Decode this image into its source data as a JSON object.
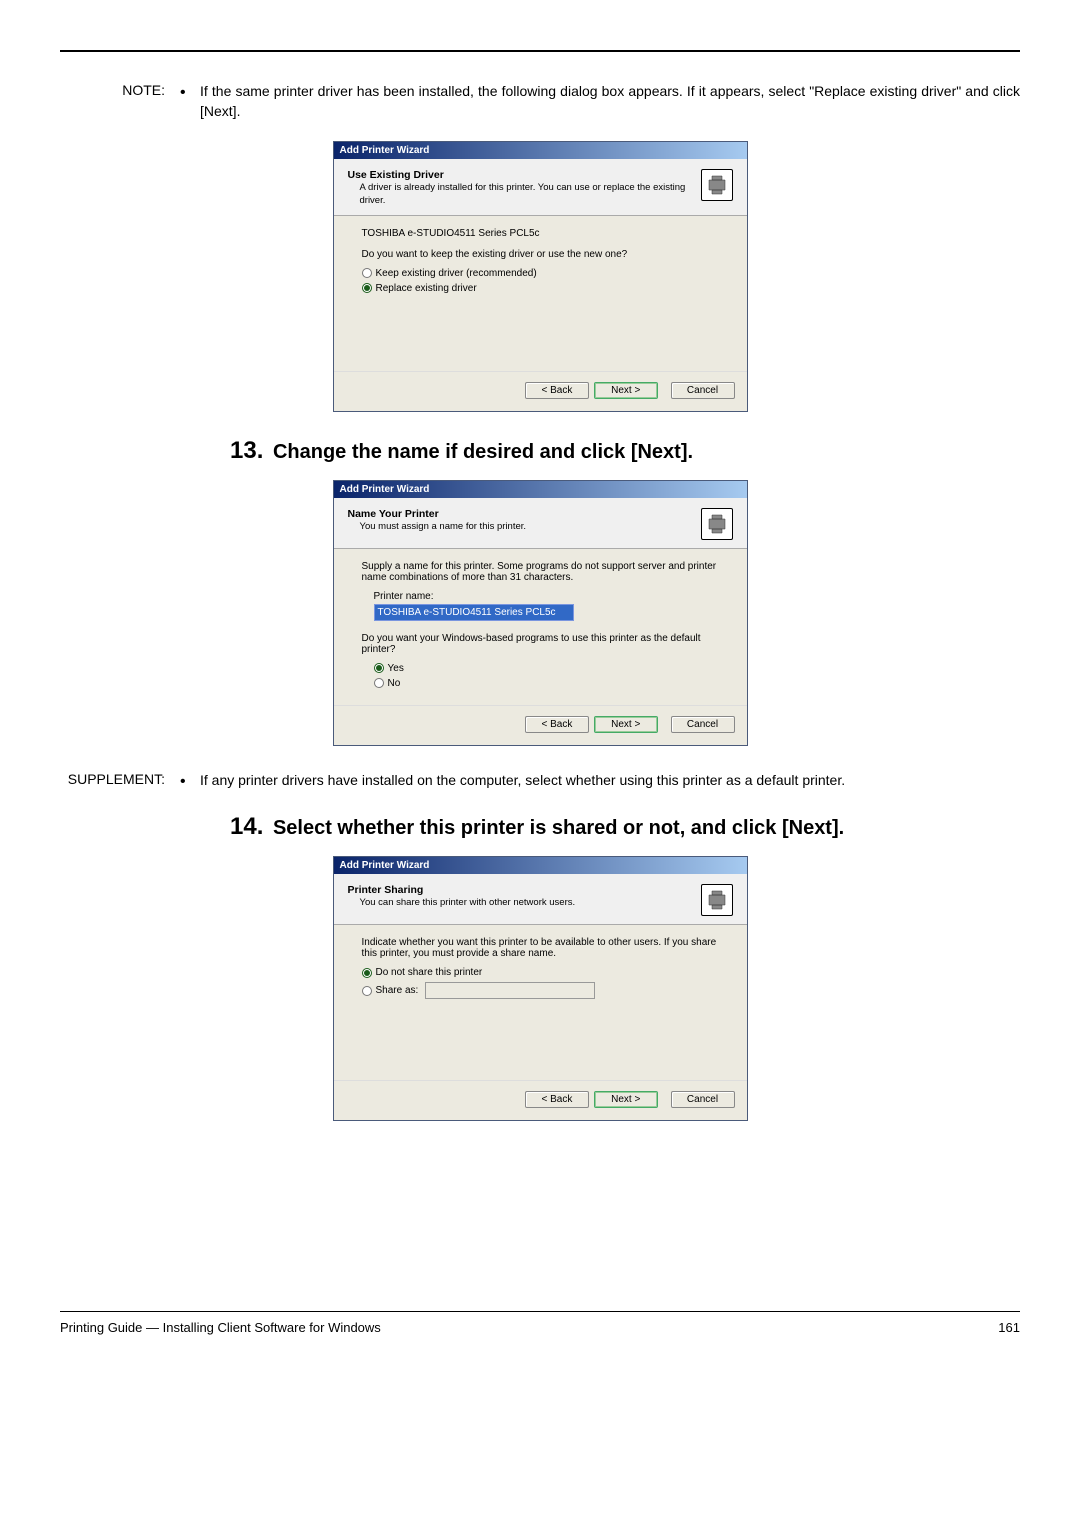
{
  "note_label": "NOTE:",
  "note1": "If the same printer driver has been installed, the following dialog box appears.  If it appears, select \"Replace existing driver\" and click [Next].",
  "dialog1": {
    "title": "Add Printer Wizard",
    "header_bold": "Use Existing Driver",
    "header_sub": "A driver is already installed for this printer. You can use or replace the existing driver.",
    "model": "TOSHIBA e-STUDIO4511 Series PCL5c",
    "question": "Do you want to keep the existing driver or use the new one?",
    "opt_keep": "Keep existing driver (recommended)",
    "opt_replace": "Replace existing driver",
    "btn_back": "< Back",
    "btn_next": "Next >",
    "btn_cancel": "Cancel"
  },
  "step13": "Change the name if desired and click [Next].",
  "dialog2": {
    "title": "Add Printer Wizard",
    "header_bold": "Name Your Printer",
    "header_sub": "You must assign a name for this printer.",
    "supply": "Supply a name for this printer. Some programs do not support server and printer name combinations of more than 31 characters.",
    "pn_label": "Printer name:",
    "pn_value": "TOSHIBA e-STUDIO4511 Series PCL5c",
    "def_q": "Do you want your Windows-based programs to use this printer as the default printer?",
    "opt_yes": "Yes",
    "opt_no": "No",
    "btn_back": "< Back",
    "btn_next": "Next >",
    "btn_cancel": "Cancel"
  },
  "supplement_label": "SUPPLEMENT:",
  "supplement_text": "If any printer drivers have installed on the computer, select whether using this printer as a default printer.",
  "step14": "Select whether this printer is shared or not, and click [Next].",
  "dialog3": {
    "title": "Add Printer Wizard",
    "header_bold": "Printer Sharing",
    "header_sub": "You can share this printer with other network users.",
    "indicate": "Indicate whether you want this printer to be available to other users. If you share this printer, you must provide a share name.",
    "opt_noshare": "Do not share this printer",
    "opt_shareas": "Share as:",
    "btn_back": "< Back",
    "btn_next": "Next >",
    "btn_cancel": "Cancel"
  },
  "footer_left": "Printing Guide — Installing Client Software for Windows",
  "footer_right": "161"
}
